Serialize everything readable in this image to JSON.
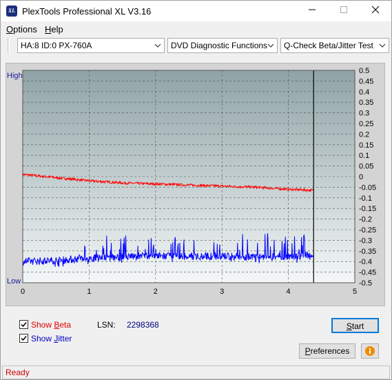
{
  "window": {
    "title": "PlexTools Professional XL V3.16",
    "icon_label": "XL"
  },
  "menu": {
    "options": "Options",
    "help": "Help"
  },
  "toolbar": {
    "drive": "HA:8 ID:0  PX-760A",
    "category": "DVD Diagnostic Functions",
    "test": "Q-Check Beta/Jitter Test"
  },
  "chart_data": {
    "type": "line",
    "left_axis": {
      "top_label": "High",
      "bottom_label": "Low"
    },
    "x": {
      "ticks": [
        "0",
        "1",
        "2",
        "3",
        "4",
        "5"
      ],
      "range": [
        0,
        5
      ],
      "cursor": 4.38
    },
    "y_right": {
      "range": [
        -0.5,
        0.5
      ],
      "ticks": [
        "0.5",
        "0.45",
        "0.4",
        "0.35",
        "0.3",
        "0.25",
        "0.2",
        "0.15",
        "0.1",
        "0.05",
        "0",
        "-0.05",
        "-0.1",
        "-0.15",
        "-0.2",
        "-0.25",
        "-0.3",
        "-0.35",
        "-0.4",
        "-0.45",
        "-0.5"
      ]
    },
    "series": [
      {
        "name": "Beta",
        "color": "#ff0000",
        "x": [
          0,
          0.5,
          1,
          1.5,
          2,
          2.5,
          3,
          3.5,
          4,
          4.38
        ],
        "values": [
          0.01,
          -0.005,
          -0.02,
          -0.03,
          -0.035,
          -0.04,
          -0.045,
          -0.05,
          -0.06,
          -0.065
        ]
      },
      {
        "name": "Jitter",
        "color": "#0000ff",
        "x": [
          0,
          0.5,
          1,
          1.5,
          2,
          2.5,
          3,
          3.5,
          4,
          4.38
        ],
        "values": [
          -0.4,
          -0.395,
          -0.385,
          -0.38,
          -0.375,
          -0.375,
          -0.375,
          -0.38,
          -0.375,
          -0.375
        ]
      }
    ],
    "grid": true
  },
  "controls": {
    "show_beta": "Show Beta",
    "show_jitter": "Show Jitter",
    "lsn_label": "LSN:",
    "lsn_value": "2298368",
    "start": "Start",
    "preferences": "Preferences",
    "beta_checked": true,
    "jitter_checked": true,
    "beta_color": "#e00000",
    "jitter_color": "#0000c0"
  },
  "status": {
    "text": "Ready",
    "color": "#cc0000"
  }
}
